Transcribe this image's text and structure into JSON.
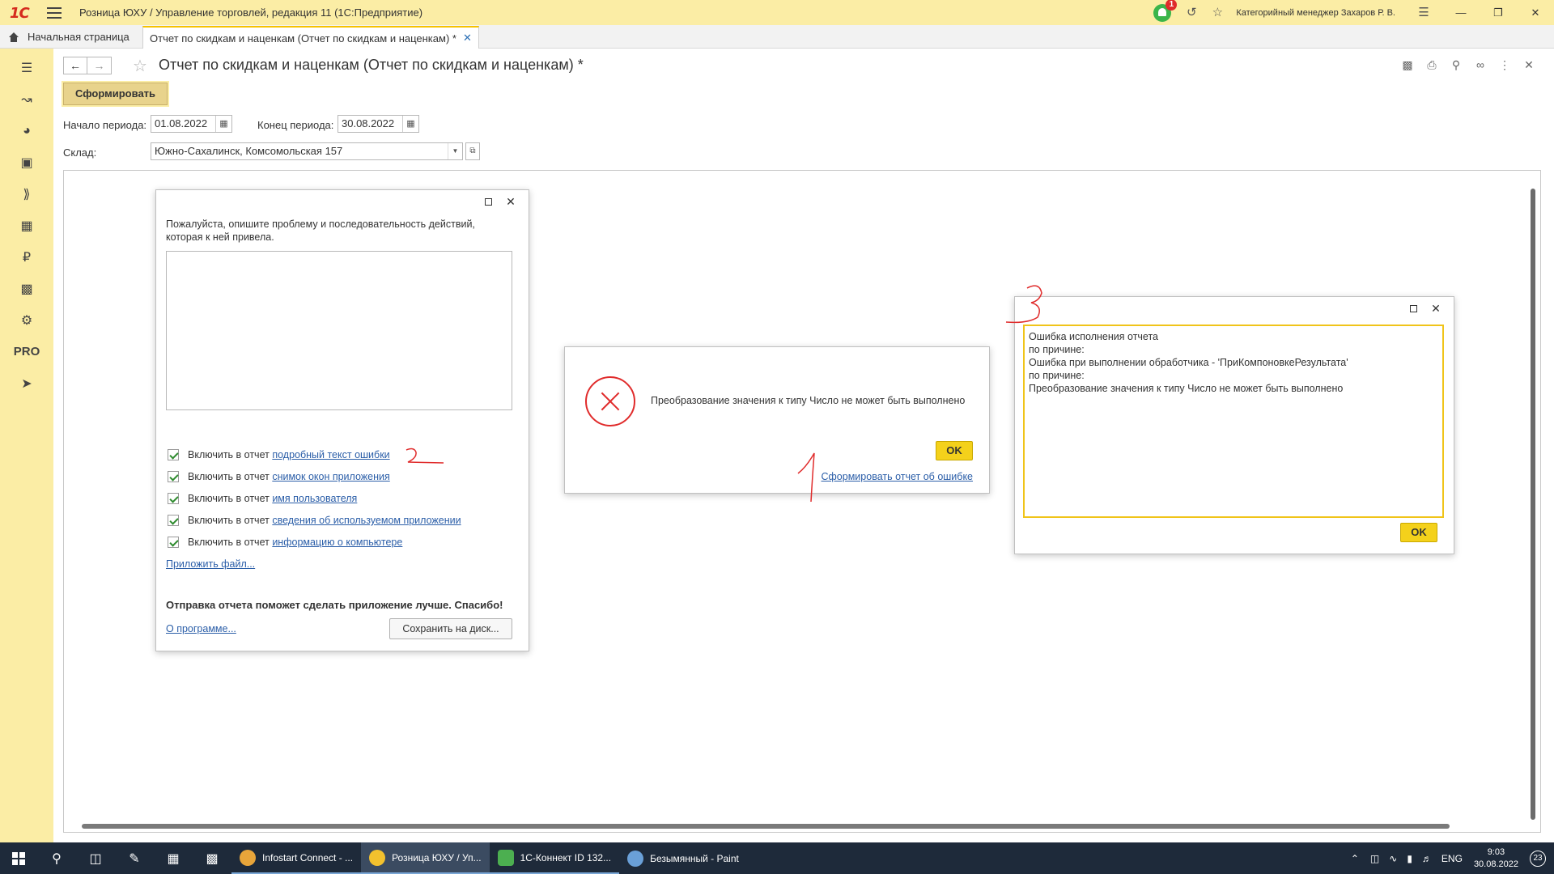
{
  "window": {
    "title": "Розница ЮХУ / Управление торговлей, редакция 11  (1С:Предприятие)",
    "logo": "1С",
    "notification_count": "1",
    "user": "Категорийный менеджер Захаров Р. В."
  },
  "tabs": {
    "home": "Начальная страница",
    "active": "Отчет по скидкам и наценкам (Отчет по скидкам и наценкам) *"
  },
  "sidebar": {
    "items": [
      "menu-icon",
      "chart-icon",
      "pie-icon",
      "bag-icon",
      "cart-icon",
      "grid-icon",
      "ruble-icon",
      "bars-icon",
      "gear-icon",
      "PRO",
      "send-icon"
    ],
    "pro_label": "PRO"
  },
  "form": {
    "title": "Отчет по скидкам и наценкам (Отчет по скидкам и наценкам) *",
    "generate_button": "Сформировать",
    "period_start_label": "Начало периода:",
    "period_start_value": "01.08.2022",
    "period_end_label": "Конец периода:",
    "period_end_value": "30.08.2022",
    "warehouse_label": "Склад:",
    "warehouse_value": "Южно-Сахалинск, Комсомольская 157"
  },
  "bug_dialog": {
    "intro": "Пожалуйста, опишите проблему и последовательность действий, которая к ней привела.",
    "checks": [
      {
        "prefix": "Включить в отчет ",
        "link": "подробный текст ошибки"
      },
      {
        "prefix": "Включить в отчет ",
        "link": "снимок окон приложения"
      },
      {
        "prefix": "Включить в отчет ",
        "link": "имя пользователя"
      },
      {
        "prefix": "Включить в отчет ",
        "link": "сведения об используемом приложении"
      },
      {
        "prefix": "Включить в отчет ",
        "link": "информацию о компьютере"
      }
    ],
    "attach": "Приложить файл...",
    "thanks": "Отправка отчета поможет сделать приложение лучше. Спасибо!",
    "about": "О программе...",
    "save_button": "Сохранить на диск..."
  },
  "error_dialog": {
    "message": "Преобразование значения к типу Число не может быть выполнено",
    "ok": "OK",
    "report_link": "Сформировать отчет об ошибке"
  },
  "report_dialog": {
    "lines": [
      "Ошибка исполнения отчета",
      "по причине:",
      "Ошибка при выполнении обработчика - 'ПриКомпоновкеРезультата'",
      "по причине:",
      "Преобразование значения к типу Число не может быть выполнено"
    ],
    "ok": "OK"
  },
  "taskbar": {
    "apps": [
      {
        "label": "Infostart Connect - ...",
        "color": "#e8a53a"
      },
      {
        "label": "Розница ЮХУ / Уп...",
        "color": "#f2c12e"
      },
      {
        "label": "1С-Коннект ID 132...",
        "color": "#4caf50"
      },
      {
        "label": "Безымянный - Paint",
        "color": "#6aa0d8"
      }
    ],
    "lang": "ENG",
    "time": "9:03",
    "date": "30.08.2022",
    "notifications": "23"
  },
  "colors": {
    "sidebar_bg": "#fbeda5",
    "ok_button": "#f4d11b",
    "error_red": "#e02b2b",
    "link": "#2b5ea8"
  }
}
